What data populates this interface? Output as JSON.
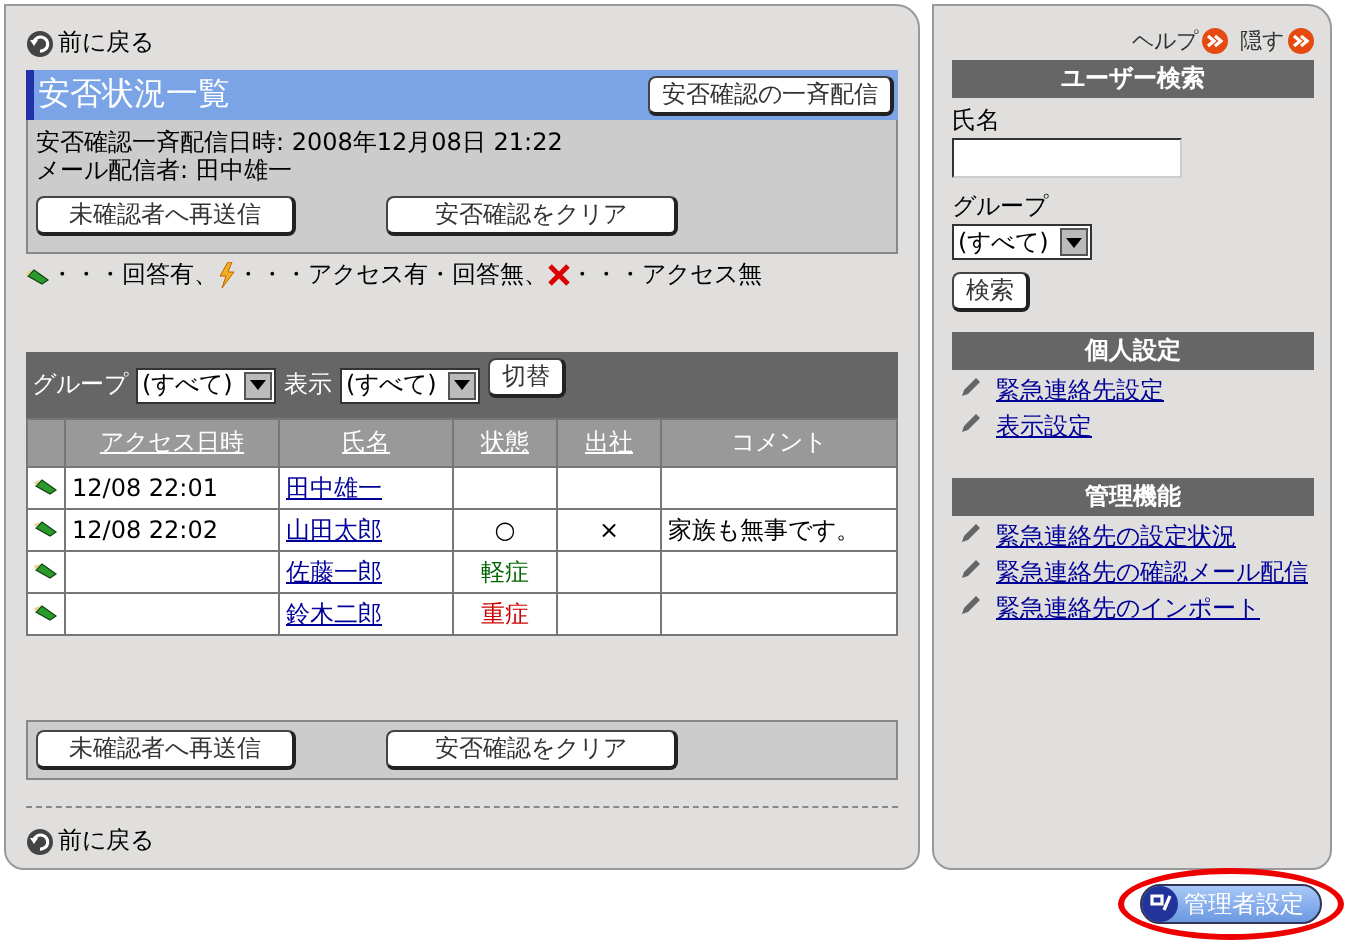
{
  "main": {
    "back_link_top": "前に戻る",
    "title": "安否状況一覧",
    "broadcast_button": "安否確認の一斉配信",
    "info_lines": [
      "安否確認一斉配信日時: 2008年12月08日 21:22",
      "メール配信者: 田中雄一"
    ],
    "action_buttons": [
      "未確認者へ再送信",
      "安否確認をクリア"
    ],
    "legend": [
      {
        "kind": "answered",
        "text": "・・・回答有、"
      },
      {
        "kind": "accessed",
        "text": "・・・アクセス有・回答無、"
      },
      {
        "kind": "none",
        "text": "・・・アクセス無"
      }
    ],
    "filter": {
      "group_label": "グループ",
      "group_value": "(すべて)",
      "display_label": "表示",
      "display_value": "(すべて)",
      "switch_button": "切替"
    },
    "table": {
      "columns": [
        "アクセス日時",
        "氏名",
        "状態",
        "出社",
        "コメント"
      ],
      "rows": [
        {
          "access": "12/08 22:01",
          "name": "田中雄一"
        },
        {
          "access": "12/08 22:02",
          "name": "山田太郎",
          "status": {
            "text": "○",
            "color": "#000000"
          },
          "attendance": "×",
          "comment": "家族も無事です。"
        },
        {
          "name": "佐藤一郎",
          "status": {
            "text": "軽症",
            "color": "#006600"
          }
        },
        {
          "name": "鈴木二郎",
          "status": {
            "text": "重症",
            "color": "#cc0000"
          }
        }
      ]
    },
    "bottom_buttons": [
      "未確認者へ再送信",
      "安否確認をクリア"
    ],
    "back_link_bottom": "前に戻る"
  },
  "sidebar": {
    "help_link": "ヘルプ",
    "hide_link": "隠す",
    "user_search": {
      "header": "ユーザー検索",
      "name_label": "氏名",
      "group_label": "グループ",
      "group_value": "(すべて)",
      "search_button": "検索"
    },
    "personal": {
      "header": "個人設定",
      "links": [
        "緊急連絡先設定",
        "表示設定"
      ]
    },
    "admin": {
      "header": "管理機能",
      "links": [
        "緊急連絡先の設定状況",
        "緊急連絡先の確認メール配信",
        "緊急連絡先のインポート"
      ]
    }
  },
  "admin_button": "管理者設定"
}
